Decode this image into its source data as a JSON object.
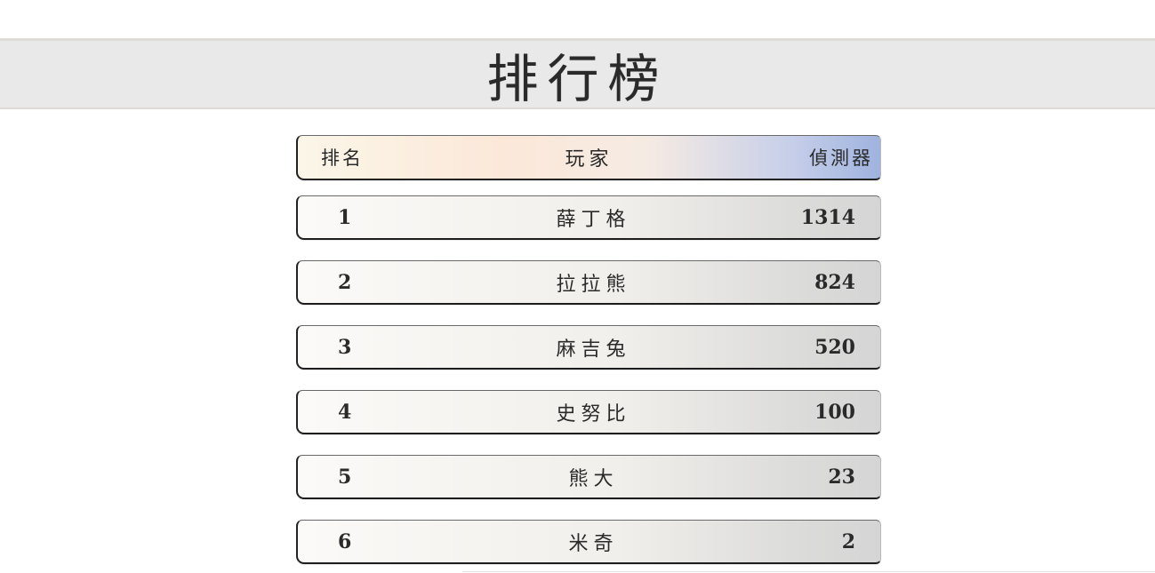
{
  "title": "排行榜",
  "table": {
    "headers": {
      "rank": "排名",
      "player": "玩家",
      "detector": "偵測器"
    },
    "rows": [
      {
        "rank": "1",
        "player": "薛丁格",
        "score": "1314"
      },
      {
        "rank": "2",
        "player": "拉拉熊",
        "score": "824"
      },
      {
        "rank": "3",
        "player": "麻吉兔",
        "score": "520"
      },
      {
        "rank": "4",
        "player": "史努比",
        "score": "100"
      },
      {
        "rank": "5",
        "player": "熊大",
        "score": "23"
      },
      {
        "rank": "6",
        "player": "米奇",
        "score": "2"
      }
    ]
  },
  "colors": {
    "title_band": "#e9e9e9",
    "header_gradient_start": "#fbf6e8",
    "header_gradient_end": "#9fb3df",
    "row_gradient_start": "#fbfaf8",
    "row_gradient_end": "#d5d5d5",
    "text": "#2a2a2a"
  }
}
